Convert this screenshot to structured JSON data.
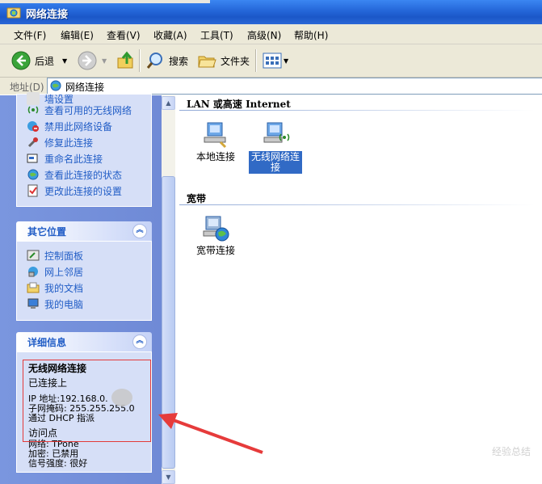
{
  "window": {
    "title": "网络连接"
  },
  "menu": [
    "文件(F)",
    "编辑(E)",
    "查看(V)",
    "收藏(A)",
    "工具(T)",
    "高级(N)",
    "帮助(H)"
  ],
  "toolbar": {
    "back": "后退",
    "search": "搜索",
    "folders": "文件夹"
  },
  "address": {
    "label": "地址(D)",
    "value": "网络连接"
  },
  "tasks_panel": {
    "items": [
      "墙设置",
      "查看可用的无线网络",
      "禁用此网络设备",
      "修复此连接",
      "重命名此连接",
      "查看此连接的状态",
      "更改此连接的设置"
    ]
  },
  "other_places": {
    "title": "其它位置",
    "items": [
      "控制面板",
      "网上邻居",
      "我的文档",
      "我的电脑"
    ]
  },
  "details": {
    "title": "详细信息",
    "name": "无线网络连接",
    "status": "已连接上",
    "ip": "IP 地址:192.168.0.",
    "mask": "子网掩码: 255.255.255.0",
    "dhcp": "通过 DHCP 指派",
    "ap": "访问点",
    "network": "网络: TPone",
    "encryption": "加密: 已禁用",
    "signal": "信号强度: 很好"
  },
  "content": {
    "group_lan": "LAN 或高速 Internet",
    "local": "本地连接",
    "wireless_line1": "无线网络连",
    "wireless_line2": "接",
    "group_broadband": "宽带",
    "broadband": "宽带连接"
  },
  "watermark": "经验总结"
}
